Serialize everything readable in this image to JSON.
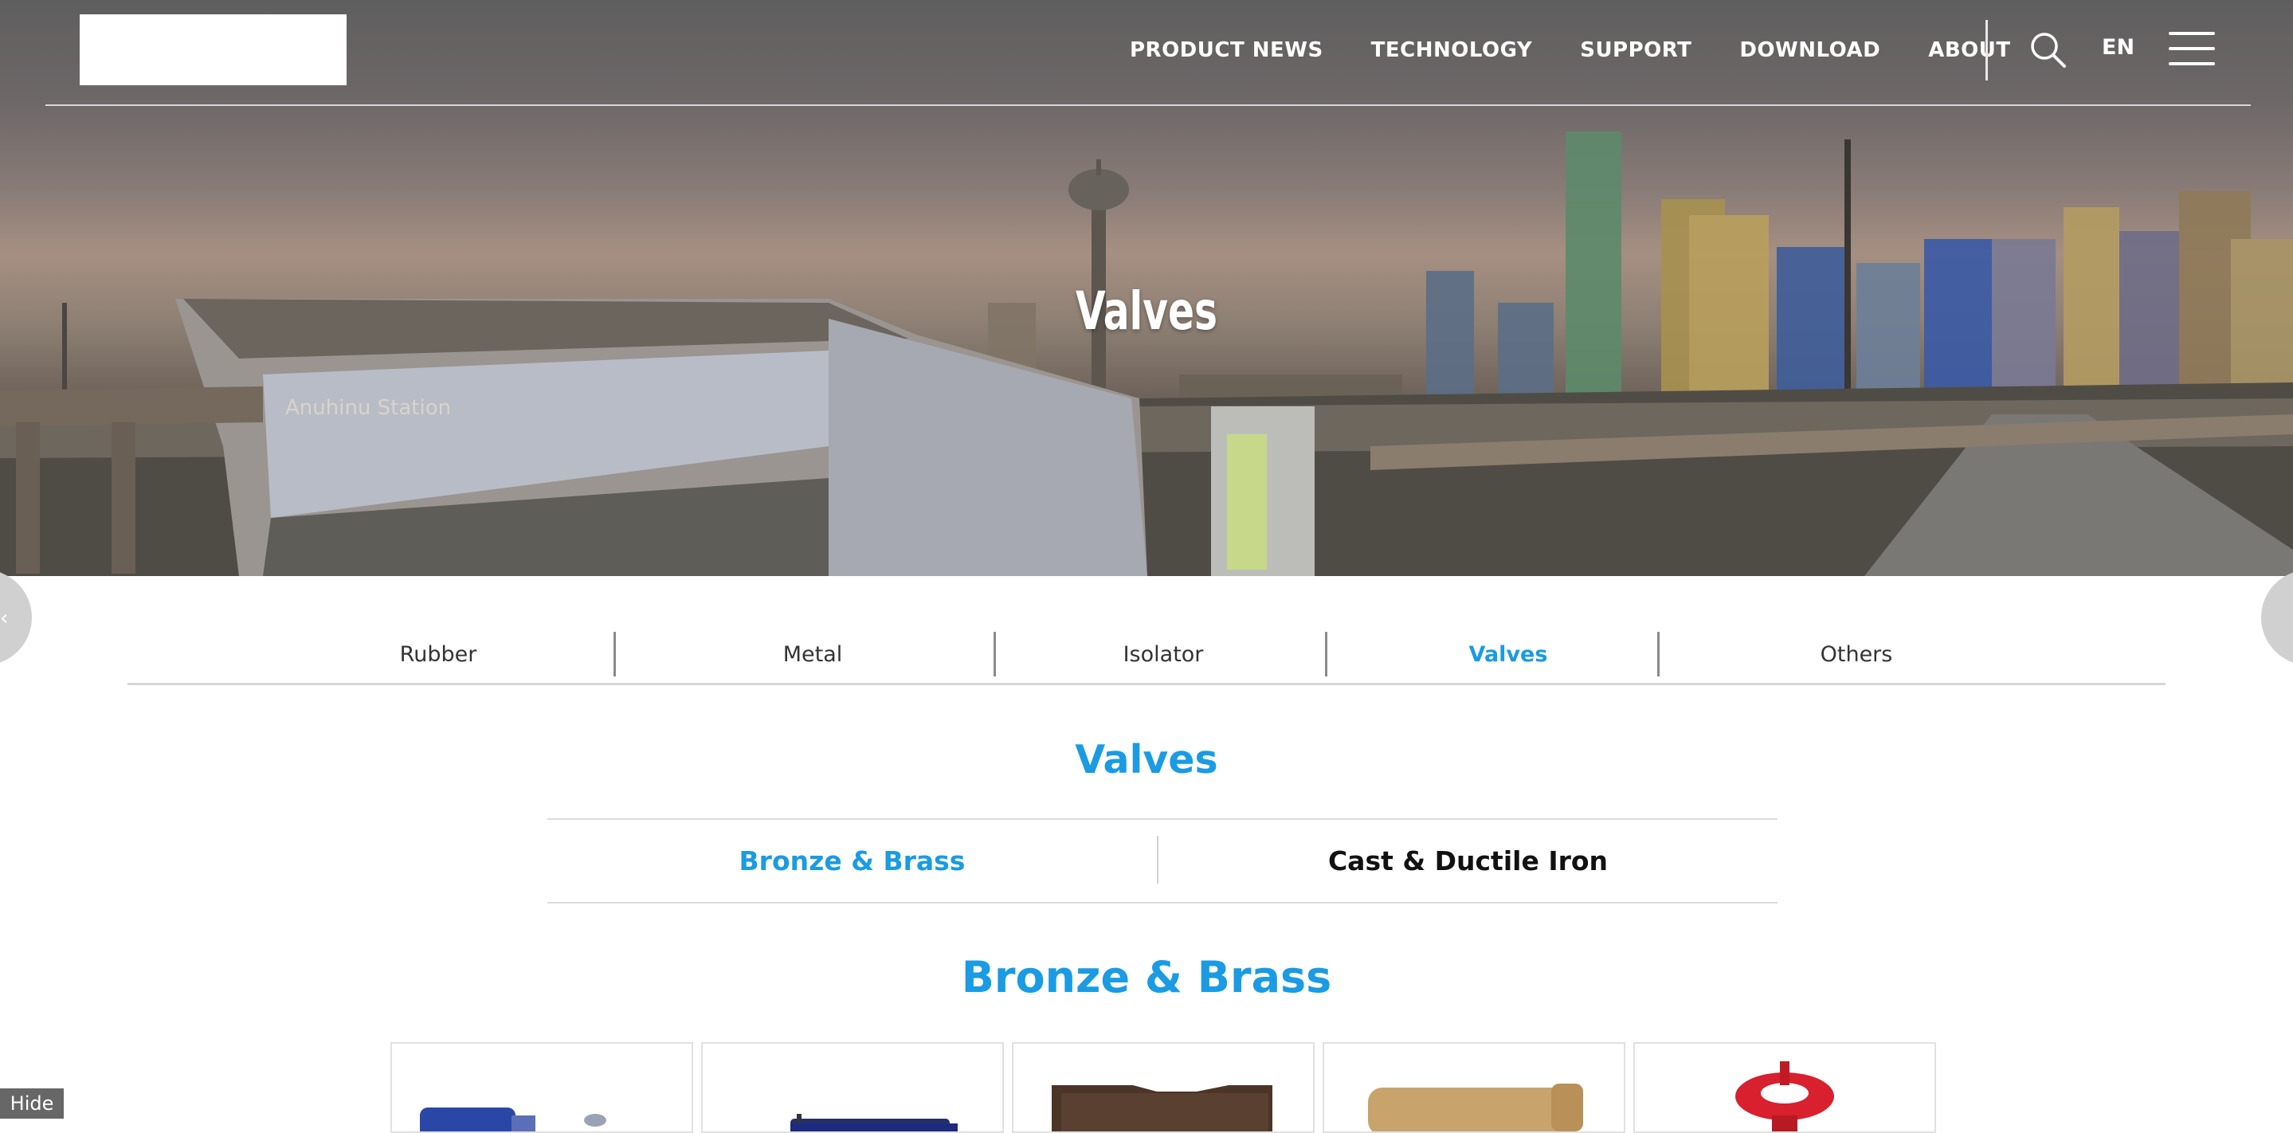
{
  "header": {
    "nav": [
      {
        "label": "PRODUCT NEWS"
      },
      {
        "label": "TECHNOLOGY"
      },
      {
        "label": "SUPPORT"
      },
      {
        "label": "DOWNLOAD"
      },
      {
        "label": "ABOUT"
      }
    ],
    "lang_label": "EN",
    "icons": {
      "search": "search-icon",
      "menu": "hamburger-menu-icon"
    }
  },
  "hero": {
    "title": "Valves",
    "sign_text": "Anuhinu Station"
  },
  "category_tabs": [
    {
      "label": "Rubber",
      "active": false
    },
    {
      "label": "Metal",
      "active": false
    },
    {
      "label": "Isolator",
      "active": false
    },
    {
      "label": "Valves",
      "active": true
    },
    {
      "label": "Others",
      "active": false
    }
  ],
  "section": {
    "title": "Valves",
    "subtabs": [
      {
        "label": "Bronze & Brass",
        "active": true
      },
      {
        "label": "Cast & Ductile Iron",
        "active": false
      }
    ],
    "subheading": "Bronze & Brass"
  },
  "products": [
    {
      "name": "blue-valve-image"
    },
    {
      "name": "blue-lever-valve-image"
    },
    {
      "name": "bronze-valve-image"
    },
    {
      "name": "brass-fitting-image"
    },
    {
      "name": "red-handwheel-valve-image"
    }
  ],
  "hide_label": "Hide",
  "colors": {
    "accent": "#1a9be3",
    "text": "#333333",
    "rule": "#d6d6d6"
  }
}
